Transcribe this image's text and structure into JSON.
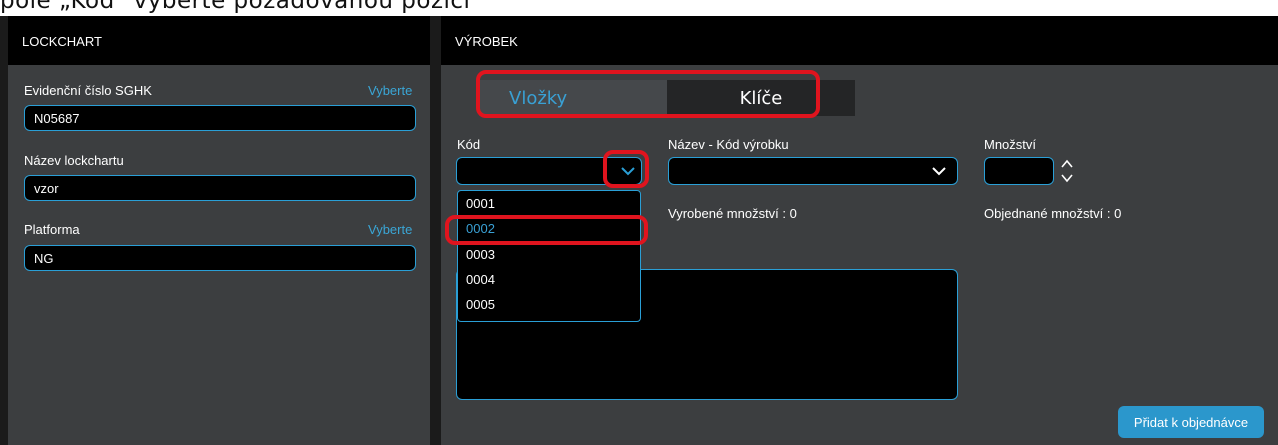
{
  "caption": "pole „Kód\" vyberte požadovanou pozici",
  "left_panel": {
    "header": "LOCKCHART",
    "evidence_label": "Evidenční číslo SGHK",
    "evidence_link": "Vyberte",
    "evidence_value": "N05687",
    "name_label": "Název lockchartu",
    "name_value": "vzor",
    "platform_label": "Platforma",
    "platform_link": "Vyberte",
    "platform_value": "NG"
  },
  "right_panel": {
    "header": "VÝROBEK",
    "tabs": [
      {
        "label": "Vložky",
        "active": true
      },
      {
        "label": "Klíče",
        "active": false
      }
    ],
    "kod_label": "Kód",
    "nazev_label": "Název - Kód výrobku",
    "mnozstvi_label": "Množství",
    "vyrobene": "Vyrobené množství : 0",
    "objednane": "Objednané množství : 0",
    "kod_options": [
      "0001",
      "0002",
      "0003",
      "0004",
      "0005"
    ],
    "kod_highlighted_option": "0002",
    "add_button": "Přidat k objednávce"
  },
  "colors": {
    "accent": "#2a9fd6",
    "highlight": "#e0141e",
    "panel": "#3c3e40"
  }
}
